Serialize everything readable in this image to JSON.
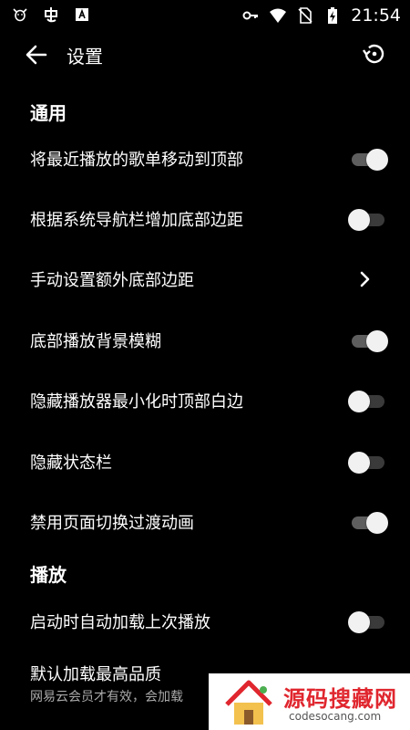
{
  "status_bar": {
    "time": "21:54",
    "left_icons": [
      "cow-icon",
      "ghost-icon",
      "a-icon"
    ],
    "right_icons": [
      "key-icon",
      "wifi-icon",
      "no-sim-icon",
      "battery-charging-icon"
    ]
  },
  "app_bar": {
    "title": "设置",
    "back_icon": "arrow-left-icon",
    "reset_icon": "restore-icon"
  },
  "sections": {
    "general": "通用",
    "playback": "播放"
  },
  "settings": {
    "move_recent": {
      "label": "将最近播放的歌单移动到顶部",
      "on": true
    },
    "nav_padding": {
      "label": "根据系统导航栏增加底部边距",
      "on": false
    },
    "manual_padding": {
      "label": "手动设置额外底部边距"
    },
    "blur_bg": {
      "label": "底部播放背景模糊",
      "on": true
    },
    "hide_top_margin": {
      "label": "隐藏播放器最小化时顶部白边",
      "on": false
    },
    "hide_status": {
      "label": "隐藏状态栏",
      "on": false
    },
    "disable_anim": {
      "label": "禁用页面切换过渡动画",
      "on": true
    },
    "auto_load": {
      "label": "启动时自动加载上次播放",
      "on": false
    },
    "highest_quality": {
      "label": "默认加载最高品质",
      "sublabel": "网易云会员才有效，会加载"
    }
  },
  "watermark": {
    "brand": "源码搜藏网",
    "domain": "codesocang.com"
  },
  "colors": {
    "background": "#000000",
    "switch_track_on": "#5e5e5e",
    "switch_thumb": "#f1f1f1",
    "watermark_red": "#e0262e"
  }
}
